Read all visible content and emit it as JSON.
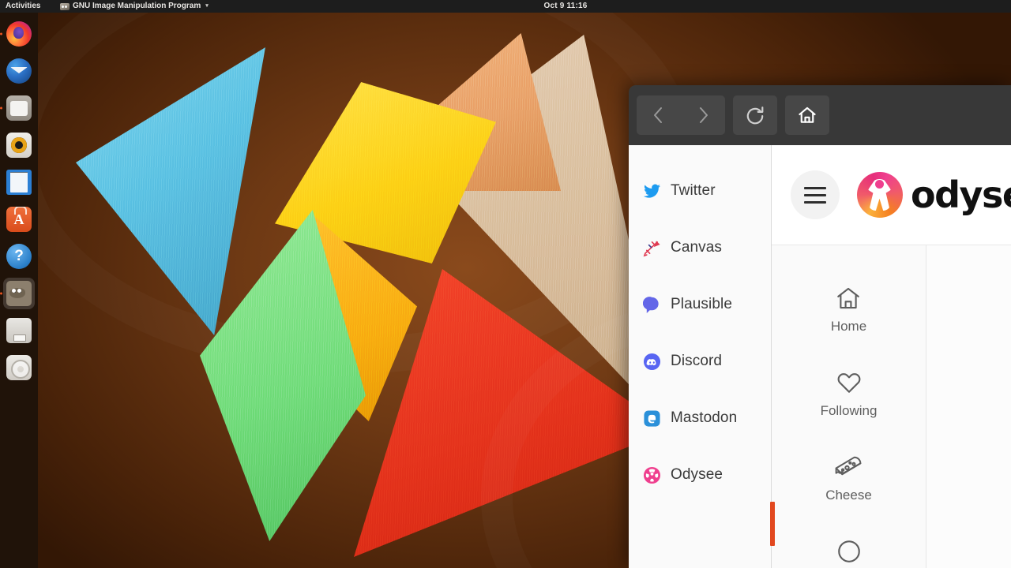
{
  "topbar": {
    "activities": "Activities",
    "app_title": "GNU Image Manipulation Program",
    "app_icon": "gimp-icon",
    "caret": "▾",
    "clock": "Oct 9  11:16"
  },
  "dock": {
    "items": [
      {
        "name": "firefox",
        "label": "Firefox Web Browser",
        "icon": "firefox-icon",
        "running": true,
        "focused": false,
        "glyph": ""
      },
      {
        "name": "thunderbird",
        "label": "Thunderbird Mail",
        "icon": "thunderbird-icon",
        "running": false,
        "focused": false,
        "glyph": ""
      },
      {
        "name": "files",
        "label": "Files",
        "icon": "files-icon",
        "running": true,
        "focused": false,
        "glyph": ""
      },
      {
        "name": "rhythmbox",
        "label": "Rhythmbox",
        "icon": "rhythmbox-icon",
        "running": false,
        "focused": false,
        "glyph": ""
      },
      {
        "name": "writer",
        "label": "LibreOffice Writer",
        "icon": "writer-icon",
        "running": false,
        "focused": false,
        "glyph": ""
      },
      {
        "name": "software",
        "label": "Ubuntu Software",
        "icon": "software-icon",
        "running": false,
        "focused": false,
        "glyph": "A"
      },
      {
        "name": "help",
        "label": "Help",
        "icon": "help-icon",
        "running": false,
        "focused": false,
        "glyph": "?"
      },
      {
        "name": "gimp",
        "label": "GNU Image Manipulation Program",
        "icon": "gimp-icon",
        "running": true,
        "focused": true,
        "glyph": ""
      },
      {
        "name": "usb",
        "label": "USB Drive",
        "icon": "usb-drive-icon",
        "running": false,
        "focused": false,
        "glyph": ""
      },
      {
        "name": "disc",
        "label": "Disc",
        "icon": "optical-disc-icon",
        "running": false,
        "focused": false,
        "glyph": ""
      }
    ]
  },
  "desktop": {
    "wallpaper_description": "Wooden tangram puzzle pieces on a brown gradient background",
    "pieces": [
      {
        "name": "blue-triangle",
        "color": "#5ec3e4"
      },
      {
        "name": "peach-triangle",
        "color": "#e9a36a"
      },
      {
        "name": "wood-triangle",
        "color": "#d8bd9c"
      },
      {
        "name": "yellow-rhombus",
        "color": "#fdd216"
      },
      {
        "name": "orange-rhombus",
        "color": "#f9ae10"
      },
      {
        "name": "green-rhombus",
        "color": "#74dd7d"
      },
      {
        "name": "red-triangle",
        "color": "#e5331c"
      }
    ]
  },
  "browser": {
    "toolbar": {
      "back_label": "Back",
      "forward_label": "Forward",
      "reload_label": "Reload",
      "home_label": "Home"
    },
    "bookmarks": {
      "active": "Odysee",
      "accent": "#e2481f",
      "items": [
        {
          "label": "Twitter",
          "icon": "twitter-icon",
          "color": "#1d9bf0"
        },
        {
          "label": "Canvas",
          "icon": "canvas-icon",
          "color": "#e03a52"
        },
        {
          "label": "Plausible",
          "icon": "plausible-icon",
          "color": "#6366e8"
        },
        {
          "label": "Discord",
          "icon": "discord-icon",
          "color": "#5865f2"
        },
        {
          "label": "Mastodon",
          "icon": "mastodon-icon",
          "color": "#2b90d9"
        },
        {
          "label": "Odysee",
          "icon": "odysee-icon",
          "color": "#ef3f8e"
        }
      ]
    },
    "page": {
      "menu_label": "Menu",
      "brand_name": "odysee",
      "brand_icon": "odysee-logo-icon",
      "nav": [
        {
          "label": "Home",
          "icon": "home-icon"
        },
        {
          "label": "Following",
          "icon": "heart-icon"
        },
        {
          "label": "Cheese",
          "icon": "cheese-icon"
        }
      ]
    }
  }
}
